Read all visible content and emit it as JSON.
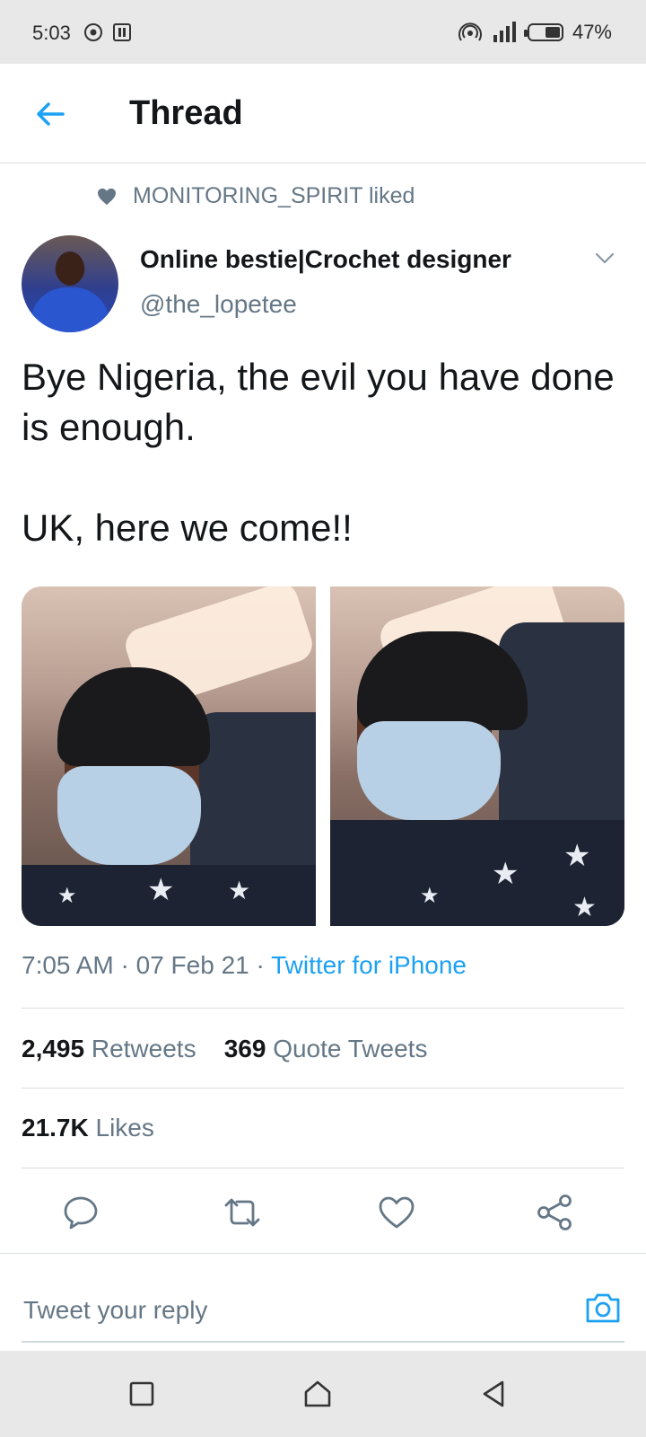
{
  "status_bar": {
    "time": "5:03",
    "battery": "47%",
    "icons": [
      "target-icon",
      "screen-record-icon",
      "hotspot-icon",
      "signal-icon",
      "battery-icon"
    ]
  },
  "header": {
    "title": "Thread",
    "back_icon": "arrow-left-icon"
  },
  "social_context": {
    "icon": "heart-filled-icon",
    "text": "MONITORING_SPIRIT liked"
  },
  "tweet": {
    "author_name": "Online bestie|Crochet designer",
    "author_handle": "@the_lopetee",
    "text": "Bye Nigeria, the evil you have done is enough.\n\nUK, here we come!!",
    "photos": [
      "photo-1",
      "photo-2"
    ],
    "time": "7:05 AM",
    "date": "07 Feb 21",
    "source": "Twitter for iPhone",
    "separator": "·",
    "stats": {
      "retweets_count": "2,495",
      "retweets_label": "Retweets",
      "quotes_count": "369",
      "quotes_label": "Quote Tweets",
      "likes_count": "21.7K",
      "likes_label": "Likes"
    },
    "actions": [
      "reply-icon",
      "retweet-icon",
      "like-icon",
      "share-icon"
    ]
  },
  "reply_bar": {
    "placeholder": "Tweet your reply",
    "icon": "camera-icon"
  },
  "nav_bar": {
    "buttons": [
      "recent-apps-icon",
      "home-icon",
      "back-icon"
    ]
  },
  "colors": {
    "accent": "#1da1f2",
    "text_primary": "#14171a",
    "text_secondary": "#657786",
    "divider": "#d9dde0",
    "system_bar": "#e8e8e8"
  }
}
